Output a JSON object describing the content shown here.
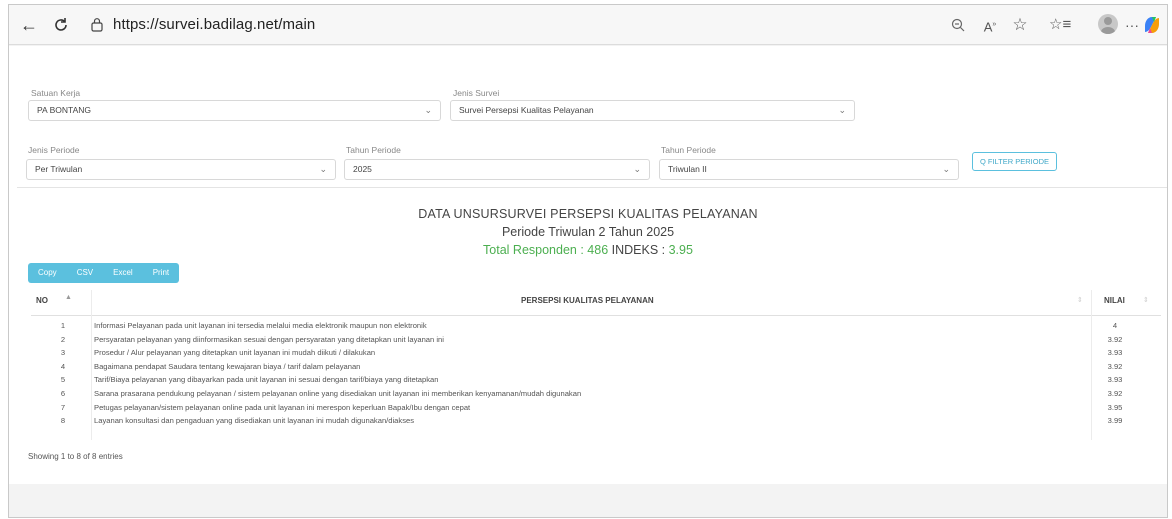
{
  "browser": {
    "url": "https://survei.badilag.net/main"
  },
  "filters": {
    "satuan_kerja": {
      "label": "Satuan Kerja",
      "value": "PA BONTANG"
    },
    "jenis_survei": {
      "label": "Jenis Survei",
      "value": "Survei Persepsi Kualitas Pelayanan"
    },
    "jenis_periode": {
      "label": "Jenis Periode",
      "value": "Per Triwulan"
    },
    "tahun_periode": {
      "label": "Tahun Periode",
      "value": "2025"
    },
    "triwulan": {
      "label": "Tahun Periode",
      "value": "Triwulan II"
    },
    "filter_button": "Q FILTER PERIODE"
  },
  "summary": {
    "title": "DATA UNSURSURVEI PERSEPSI KUALITAS PELAYANAN",
    "subtitle": "Periode Triwulan 2 Tahun 2025",
    "responden_label": "Total Responden : ",
    "responden_value": "486",
    "indeks_label": " INDEKS : ",
    "indeks_value": "3.95"
  },
  "export_buttons": [
    "Copy",
    "CSV",
    "Excel",
    "Print"
  ],
  "table": {
    "headers": {
      "no": "NO",
      "persepsi": "PERSEPSI KUALITAS PELAYANAN",
      "nilai": "NILAI"
    },
    "rows": [
      {
        "no": "1",
        "desc": "Informasi Pelayanan pada unit layanan ini tersedia melalui media elektronik maupun non elektronik",
        "val": "4"
      },
      {
        "no": "2",
        "desc": "Persyaratan pelayanan yang diinformasikan sesuai dengan persyaratan yang ditetapkan unit layanan ini",
        "val": "3.92"
      },
      {
        "no": "3",
        "desc": "Prosedur / Alur pelayanan yang ditetapkan unit layanan ini mudah diikuti / dilakukan",
        "val": "3.93"
      },
      {
        "no": "4",
        "desc": "Bagaimana pendapat Saudara tentang kewajaran biaya / tarif dalam pelayanan",
        "val": "3.92"
      },
      {
        "no": "5",
        "desc": "Tarif/Biaya pelayanan yang dibayarkan pada unit layanan ini sesuai dengan tarif/biaya yang ditetapkan",
        "val": "3.93"
      },
      {
        "no": "6",
        "desc": "Sarana prasarana pendukung pelayanan / sistem pelayanan online yang disediakan unit layanan ini memberikan kenyamanan/mudah digunakan",
        "val": "3.92"
      },
      {
        "no": "7",
        "desc": "Petugas pelayanan/sistem pelayanan online pada unit layanan ini merespon keperluan Bapak/Ibu dengan cepat",
        "val": "3.95"
      },
      {
        "no": "8",
        "desc": "Layanan konsultasi dan pengaduan yang disediakan unit layanan ini mudah digunakan/diakses",
        "val": "3.99"
      }
    ]
  },
  "footer": {
    "info": "Showing 1 to 8 of 8 entries"
  },
  "colors": {
    "accent": "#5bc0de",
    "green": "#4caf50"
  }
}
